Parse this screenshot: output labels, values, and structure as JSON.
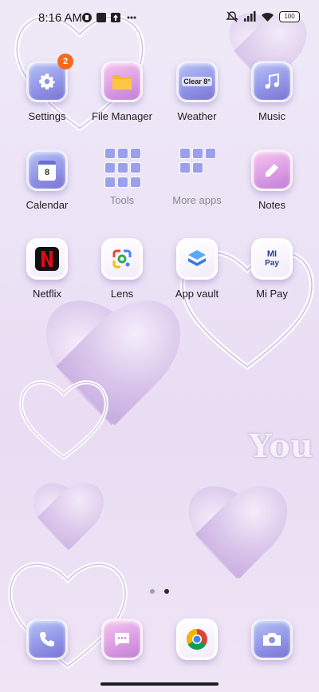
{
  "status_bar": {
    "time": "8:16 AM",
    "battery": "100",
    "icons": [
      "notification-icon",
      "gallery-icon",
      "upload-icon",
      "more-dots-icon",
      "mute-icon",
      "signal-icon",
      "wifi-icon",
      "battery-icon"
    ]
  },
  "apps": {
    "settings": {
      "label": "Settings",
      "badge": "2"
    },
    "file_manager": {
      "label": "File Manager"
    },
    "weather": {
      "label": "Weather",
      "icon_text": "Clear 8°"
    },
    "music": {
      "label": "Music"
    },
    "calendar": {
      "label": "Calendar",
      "day": "8"
    },
    "tools": {
      "label": "Tools"
    },
    "more_apps": {
      "label": "More apps"
    },
    "notes": {
      "label": "Notes"
    },
    "netflix": {
      "label": "Netflix"
    },
    "lens": {
      "label": "Lens"
    },
    "app_vault": {
      "label": "App vault"
    },
    "mi_pay": {
      "label": "Mi Pay",
      "icon_text_1": "MI",
      "icon_text_2": "Pay"
    }
  },
  "dock": [
    "phone-icon",
    "messages-icon",
    "chrome-icon",
    "camera-icon"
  ],
  "wallpaper_text": "You",
  "page_dots": {
    "count": 2,
    "active_index": 1
  },
  "colors": {
    "badge": "#f26b1d",
    "icon_blue": "#8f93e6",
    "icon_pink": "#d99ae3"
  }
}
